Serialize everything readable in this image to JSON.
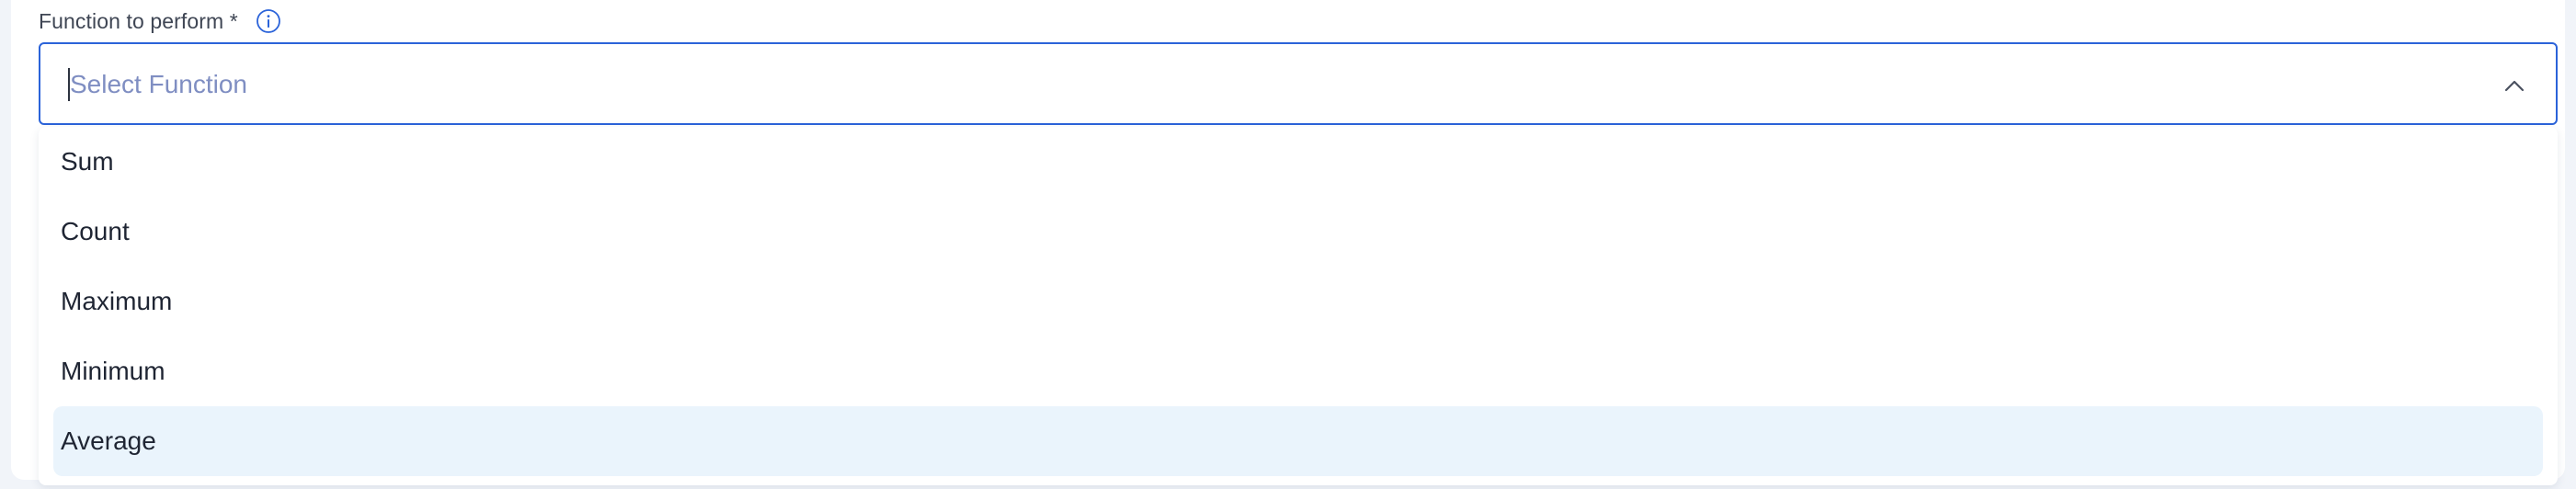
{
  "field": {
    "label": "Function to perform *",
    "info_icon": "info-circle-icon"
  },
  "select": {
    "placeholder": "Select Function",
    "value": "",
    "expanded": true,
    "chevron_icon": "chevron-up-icon"
  },
  "options": [
    {
      "label": "Sum",
      "highlighted": false
    },
    {
      "label": "Count",
      "highlighted": false
    },
    {
      "label": "Maximum",
      "highlighted": false
    },
    {
      "label": "Minimum",
      "highlighted": false
    },
    {
      "label": "Average",
      "highlighted": true
    }
  ],
  "colors": {
    "accent": "#2b63d9",
    "placeholder": "#7f8ec2",
    "highlight": "#eaf4fc",
    "text": "#1f2533",
    "label": "#3f4654"
  }
}
